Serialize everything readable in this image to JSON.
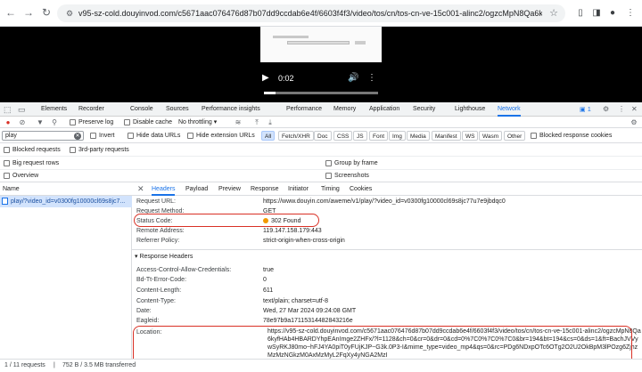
{
  "browser": {
    "url": "v95-sz-cold.douyinvod.com/c5671aac076476d87b07dd9ccdab6e4f/6603f4f3/video/tos/cn/tos-cn-ve-15c001-alinc2/ogzcMpN8Qa6kyfH..."
  },
  "video": {
    "time": "0:02",
    "progress": 0.1
  },
  "devtools": {
    "tabs": [
      "Elements",
      "Recorder",
      "Console",
      "Sources",
      "Performance insights",
      "Performance",
      "Memory",
      "Application",
      "Security",
      "Lighthouse",
      "Network"
    ],
    "issues_count": "1",
    "toolbar": {
      "preserve_log": "Preserve log",
      "disable_cache": "Disable cache",
      "throttling": "No throttling"
    },
    "filter": {
      "value": "play",
      "invert": "Invert",
      "hide_data_urls": "Hide data URLs",
      "hide_extension_urls": "Hide extension URLs",
      "types": [
        "All",
        "Fetch/XHR",
        "Doc",
        "CSS",
        "JS",
        "Font",
        "Img",
        "Media",
        "Manifest",
        "WS",
        "Wasm",
        "Other"
      ],
      "blocked_response_cookies": "Blocked response cookies"
    },
    "options": {
      "blocked_requests": "Blocked requests",
      "third_party": "3rd-party requests",
      "big_request_rows": "Big request rows",
      "group_by_frame": "Group by frame",
      "overview": "Overview",
      "screenshots": "Screenshots"
    },
    "request_list": {
      "header": "Name",
      "items": [
        "play/?video_id=v0300fg10000cl69s8jc7..."
      ]
    },
    "detail": {
      "tabs": [
        "Headers",
        "Payload",
        "Preview",
        "Response",
        "Initiator",
        "Timing",
        "Cookies"
      ],
      "general": [
        {
          "key": "Request URL:",
          "value": "https://www.douyin.com/aweme/v1/play/?video_id=v0300fg10000cl69s8jc77u7e9jbdqc0"
        },
        {
          "key": "Request Method:",
          "value": "GET"
        },
        {
          "key": "Status Code:",
          "value": "302 Found"
        },
        {
          "key": "Remote Address:",
          "value": "119.147.158.179:443"
        },
        {
          "key": "Referrer Policy:",
          "value": "strict-origin-when-cross-origin"
        }
      ],
      "response_headers_title": "▾ Response Headers",
      "response_headers": [
        {
          "key": "Access-Control-Allow-Credentials:",
          "value": "true"
        },
        {
          "key": "Bd-Tt-Error-Code:",
          "value": "0"
        },
        {
          "key": "Content-Length:",
          "value": "611"
        },
        {
          "key": "Content-Type:",
          "value": "text/plain; charset=utf-8"
        },
        {
          "key": "Date:",
          "value": "Wed, 27 Mar 2024 09:24:08 GMT"
        },
        {
          "key": "Eagleid:",
          "value": "78e97b9a17115314482843216e"
        }
      ],
      "location_key": "Location:",
      "location_value": "https://v95-sz-cold.douyinvod.com/c5671aac076476d87b07dd9ccdab6e4f/6603f4f3/video/tos/cn/tos-cn-ve-15c001-alinc2/ogzcMpN8Qa6kyfHAb4HBARDYhpEAnImge2ZHFx/?l=1128&ch=0&cr=0&dr=0&cd=0%7C0%7C0%7C0&br=194&bt=194&cs=0&ds=1&ft=BachJVVywSyRKJ80mo~hFJ4YA0piT0yFUjKJP~G3k.0P3-I&mime_type=video_mp4&qs=0&rc=PDg6NDxpOTc6OTg2O2U2OkBpM3lPOzg6ZjhzMzMzNGkzM0AxMzMyL2FqXy4yNGA2MzI"
    }
  },
  "status": {
    "requests": "1 / 11 requests",
    "transferred": "752 B / 3.5 MB transferred"
  }
}
